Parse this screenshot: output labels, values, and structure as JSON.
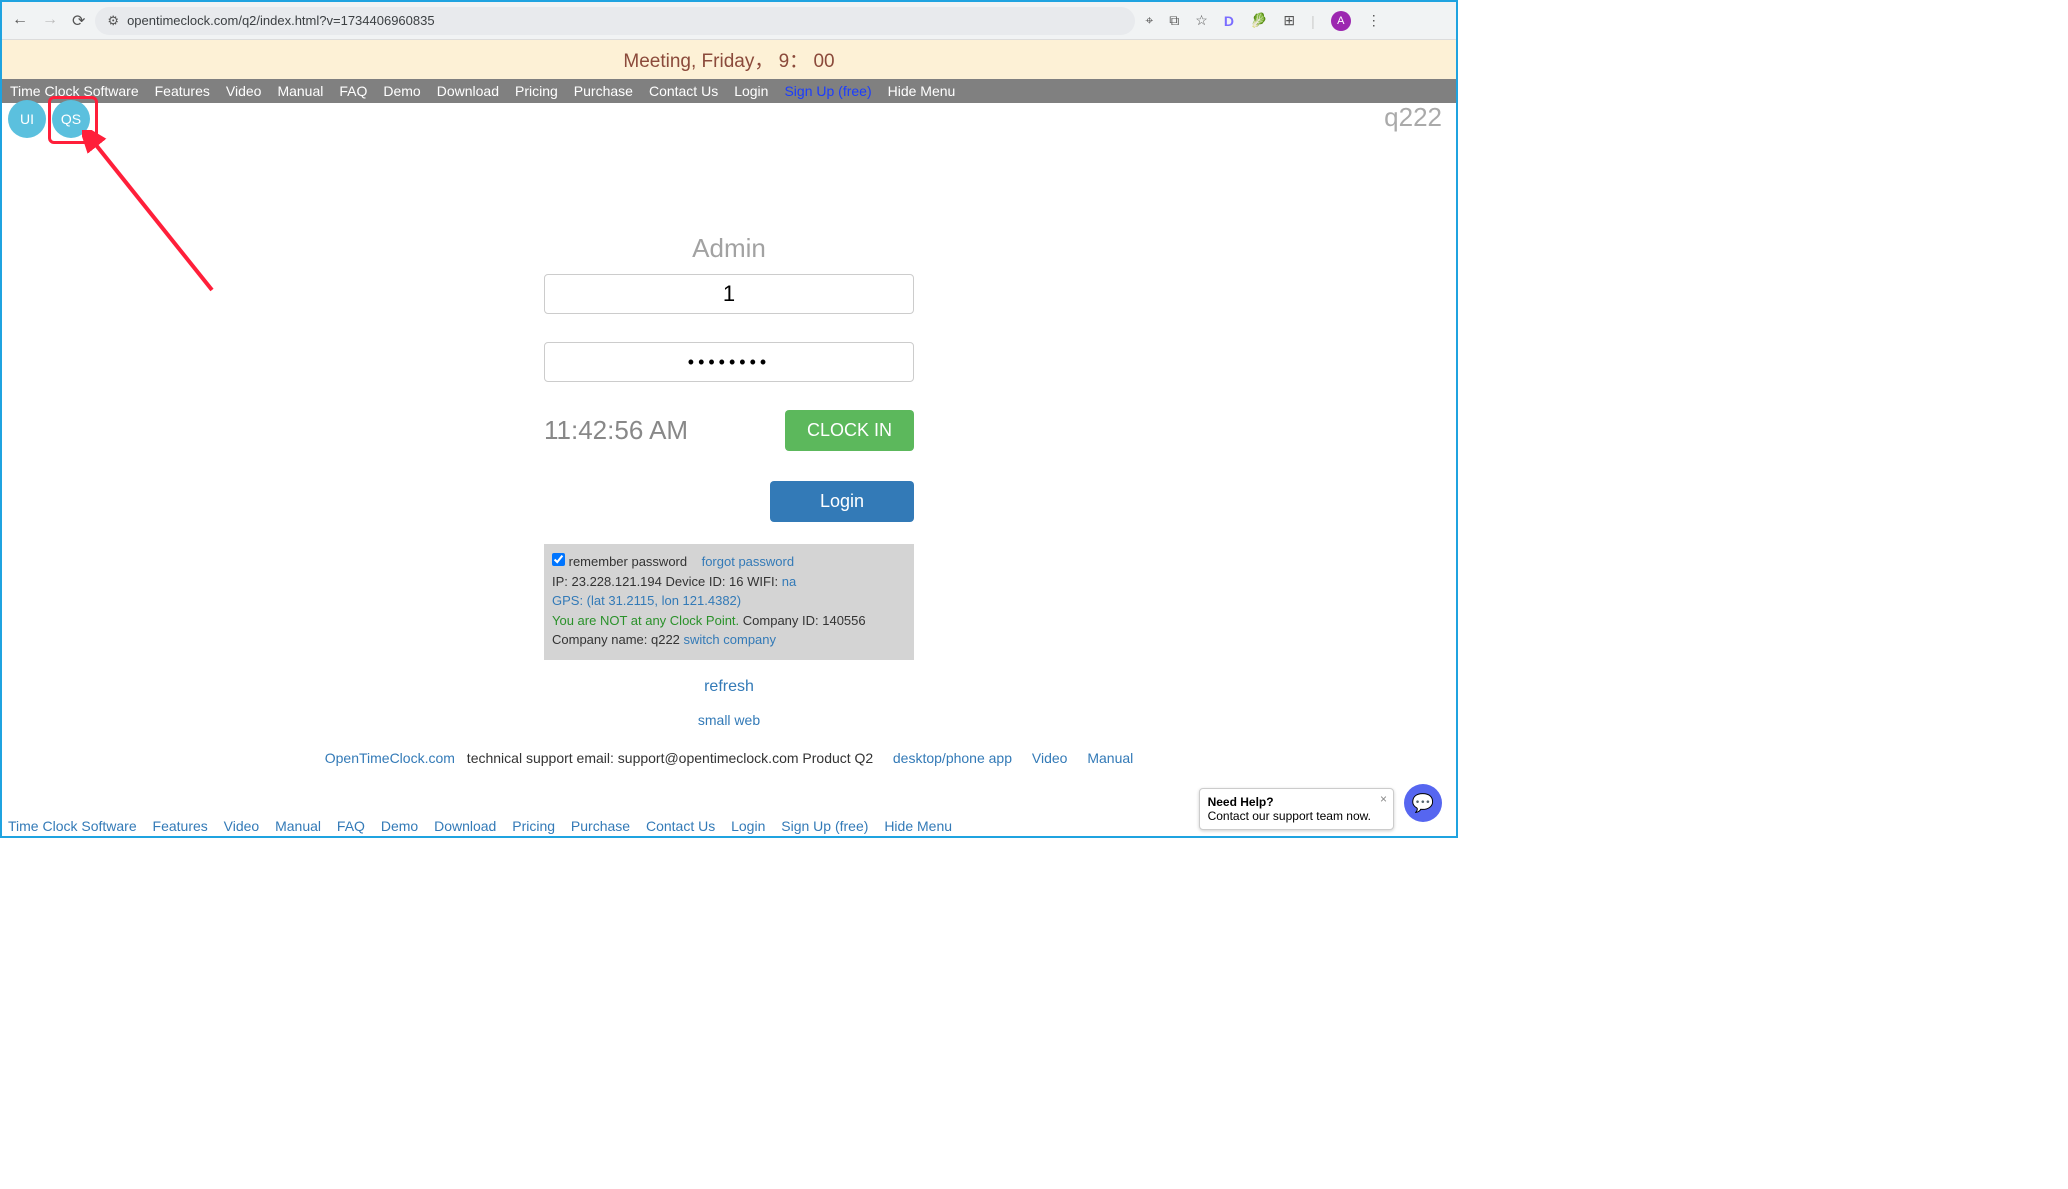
{
  "browser": {
    "url": "opentimeclock.com/q2/index.html?v=1734406960835",
    "avatar_letter": "A"
  },
  "meeting_banner": "Meeting, Friday， 9： 00",
  "menu": {
    "items": [
      "Time Clock Software",
      "Features",
      "Video",
      "Manual",
      "FAQ",
      "Demo",
      "Download",
      "Pricing",
      "Purchase",
      "Contact Us",
      "Login",
      "Sign Up (free)",
      "Hide Menu"
    ]
  },
  "ui_btn": "UI",
  "qs_btn": "QS",
  "brand_corner": "q222",
  "login_form": {
    "title": "Admin",
    "username_value": "1",
    "password_value": "••••••••",
    "time": "11:42:56 AM",
    "clock_in": "CLOCK IN",
    "login": "Login"
  },
  "info": {
    "remember_label": "remember password",
    "forgot": "forgot password",
    "ip_line": "IP: 23.228.121.194   Device ID: 16    WIFI: ",
    "wifi_na": "na",
    "gps": "GPS: (lat 31.2115, lon 121.4382)",
    "clockpoint": "You are NOT at any Clock Point.",
    "company_id": "  Company ID: 140556",
    "company_name": "Company name: q222  ",
    "switch": "switch company",
    "refresh": "refresh"
  },
  "smallweb": "small web",
  "support": {
    "otc": "OpenTimeClock.com",
    "line": " technical support email: support@opentimeclock.com Product Q2",
    "desktop": "desktop/phone app",
    "video": "Video",
    "manual": "Manual"
  },
  "bottom_menu": [
    "Time Clock Software",
    "Features",
    "Video",
    "Manual",
    "FAQ",
    "Demo",
    "Download",
    "Pricing",
    "Purchase",
    "Contact Us",
    "Login",
    "Sign Up (free)",
    "Hide Menu"
  ],
  "help": {
    "title": "Need Help?",
    "sub": "Contact our support team now."
  }
}
